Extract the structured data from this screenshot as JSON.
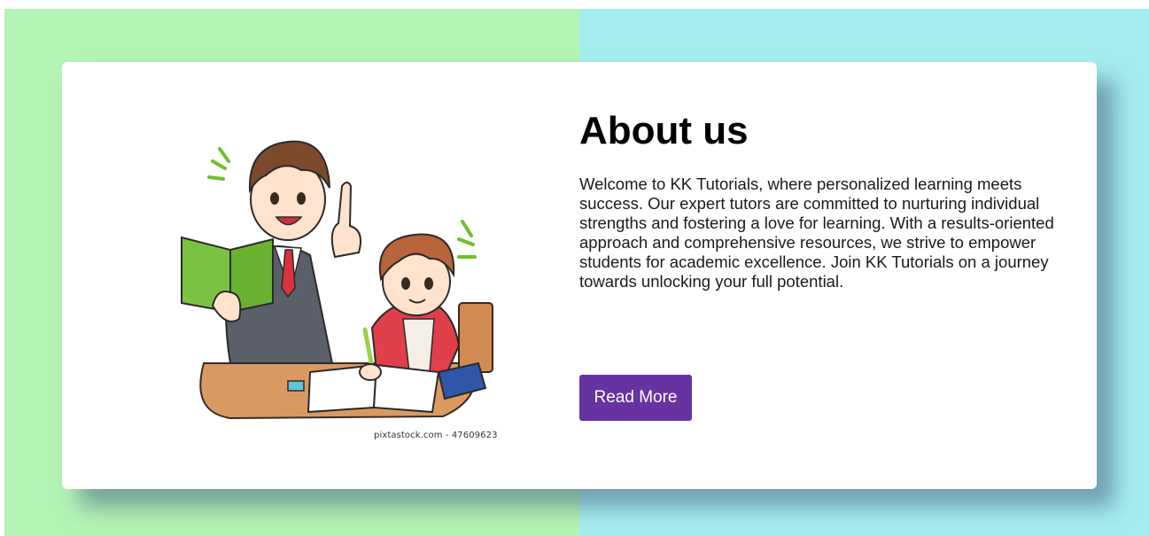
{
  "about": {
    "title": "About us",
    "description": "Welcome to KK Tutorials, where personalized learning meets success. Our expert tutors are committed to nurturing individual strengths and fostering a love for learning. With a results-oriented approach and comprehensive resources, we strive to empower students for academic excellence. Join KK Tutorials on a journey towards unlocking your full potential.",
    "read_more_label": "Read More"
  },
  "illustration": {
    "icon": "tutor-and-student-illustration",
    "credit": "pixtastock.com - 47609623"
  },
  "colors": {
    "background_left": "#b3f3b3",
    "background_right": "#a5ecee",
    "card": "#ffffff",
    "button": "#6633a0",
    "button_text": "#ffffff",
    "title": "#000000"
  }
}
